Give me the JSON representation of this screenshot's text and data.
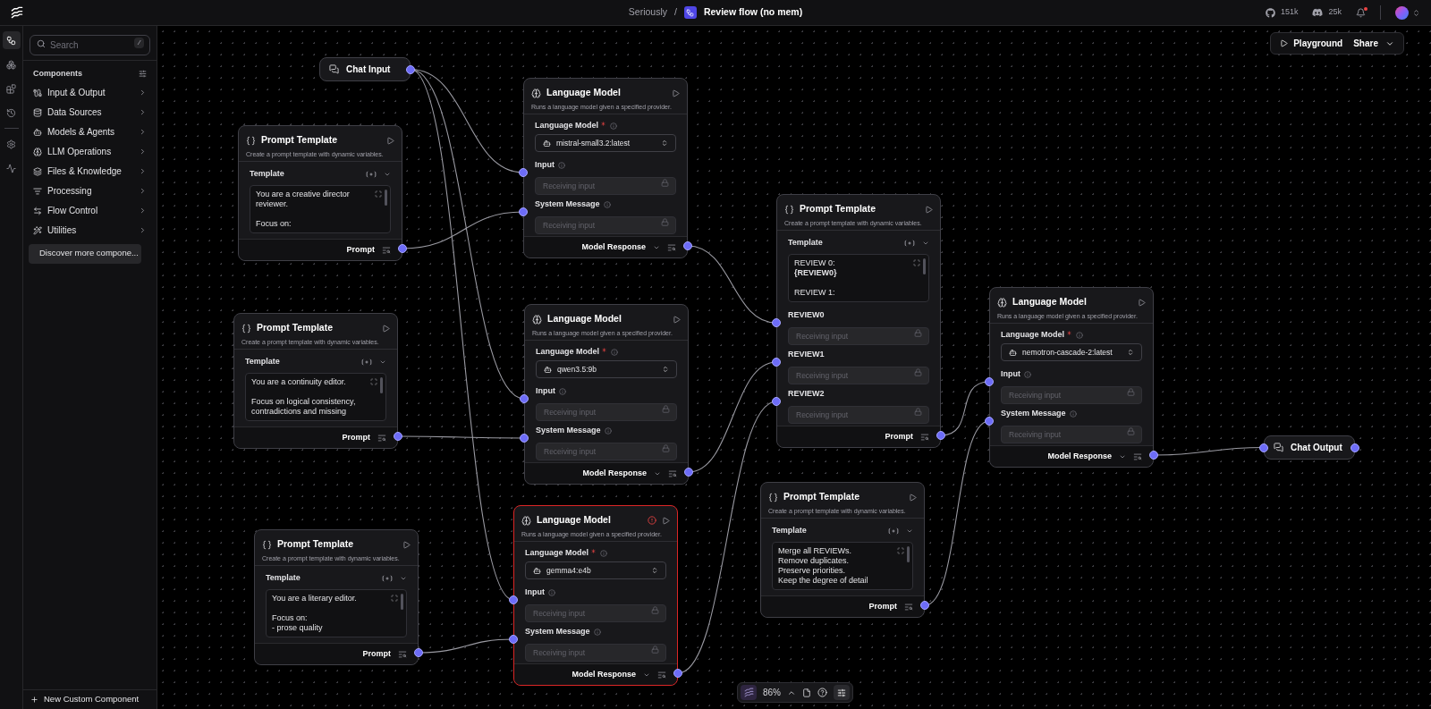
{
  "topbar": {
    "project": "Seriously",
    "separator": "/",
    "flow_name": "Review flow (no mem)",
    "github_stars": "151k",
    "discord_members": "25k",
    "has_notifications": true
  },
  "rail": [
    {
      "selected": true
    },
    {
      "selected": false
    },
    {
      "selected": false
    },
    {
      "selected": false
    },
    {
      "selected": false
    },
    {
      "selected": false
    }
  ],
  "sidebar": {
    "search": {
      "placeholder": "Search",
      "shortcut": "/"
    },
    "title": "Components",
    "categories": [
      {
        "label": "Input & Output"
      },
      {
        "label": "Data Sources"
      },
      {
        "label": "Models & Agents"
      },
      {
        "label": "LLM Operations"
      },
      {
        "label": "Files & Knowledge"
      },
      {
        "label": "Processing"
      },
      {
        "label": "Flow Control"
      },
      {
        "label": "Utilities"
      }
    ],
    "discover": "Discover more compone...",
    "new_component": "New Custom Component"
  },
  "canvas_toolbar": {
    "playground": "Playground",
    "share": "Share"
  },
  "nodes": [
    {
      "kind": "chat_input",
      "title": "Chat Input"
    },
    {
      "kind": "prompt_template",
      "title": "Prompt Template",
      "description": "Create a prompt template with dynamic variables.",
      "template_label": "Template",
      "template": "You are a creative director\nreviewer.\n\nFocus on:",
      "output": "Prompt"
    },
    {
      "kind": "language_model",
      "title": "Language Model",
      "description": "Runs a language model given a specified provider.",
      "error": false,
      "model_label": "Language Model",
      "required": true,
      "model": "mistral-small3.2:latest",
      "inputs": [
        {
          "label": "Input",
          "placeholder": "Receiving input"
        },
        {
          "label": "System Message",
          "placeholder": "Receiving input"
        }
      ],
      "output": "Model Response"
    },
    {
      "kind": "prompt_template",
      "title": "Prompt Template",
      "description": "Create a prompt template with dynamic variables.",
      "template_label": "Template",
      "template": "REVIEW 0:\n**{REVIEW0}**\n\nREVIEW 1:",
      "variables": [
        {
          "label": "REVIEW0",
          "placeholder": "Receiving input"
        },
        {
          "label": "REVIEW1",
          "placeholder": "Receiving input"
        },
        {
          "label": "REVIEW2",
          "placeholder": "Receiving input"
        }
      ],
      "output": "Prompt"
    },
    {
      "kind": "language_model",
      "title": "Language Model",
      "description": "Runs a language model given a specified provider.",
      "error": false,
      "model_label": "Language Model",
      "required": true,
      "model": "nemotron-cascade-2:latest",
      "inputs": [
        {
          "label": "Input",
          "placeholder": "Receiving input"
        },
        {
          "label": "System Message",
          "placeholder": "Receiving input"
        }
      ],
      "output": "Model Response"
    },
    {
      "kind": "prompt_template",
      "title": "Prompt Template",
      "description": "Create a prompt template with dynamic variables.",
      "template_label": "Template",
      "template": "You are a continuity editor.\n\nFocus on logical consistency,\ncontradictions and missing",
      "output": "Prompt"
    },
    {
      "kind": "language_model",
      "title": "Language Model",
      "description": "Runs a language model given a specified provider.",
      "error": false,
      "model_label": "Language Model",
      "required": true,
      "model": "qwen3.5:9b",
      "inputs": [
        {
          "label": "Input",
          "placeholder": "Receiving input"
        },
        {
          "label": "System Message",
          "placeholder": "Receiving input"
        }
      ],
      "output": "Model Response"
    },
    {
      "kind": "chat_output",
      "title": "Chat Output"
    },
    {
      "kind": "prompt_template",
      "title": "Prompt Template",
      "description": "Create a prompt template with dynamic variables.",
      "template_label": "Template",
      "template": "You are a literary editor.\n\nFocus on:\n- prose quality",
      "output": "Prompt"
    },
    {
      "kind": "language_model",
      "title": "Language Model",
      "description": "Runs a language model given a specified provider.",
      "error": true,
      "model_label": "Language Model",
      "required": true,
      "model": "gemma4:e4b",
      "inputs": [
        {
          "label": "Input",
          "placeholder": "Receiving input"
        },
        {
          "label": "System Message",
          "placeholder": "Receiving input"
        }
      ],
      "output": "Model Response"
    },
    {
      "kind": "prompt_template",
      "title": "Prompt Template",
      "description": "Create a prompt template with dynamic variables.",
      "template_label": "Template",
      "template": "Merge all REVIEWs.\nRemove duplicates.\nPreserve priorities.\nKeep the degree of detail",
      "output": "Prompt"
    }
  ],
  "zoom_bar": {
    "zoom": "86%"
  }
}
